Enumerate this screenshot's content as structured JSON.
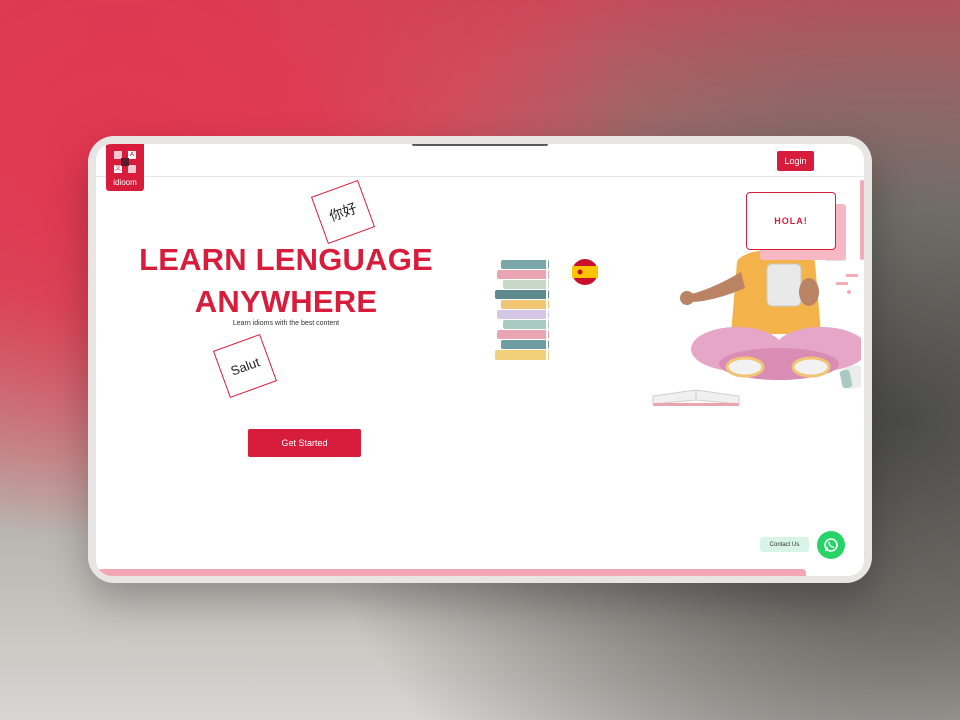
{
  "brand": {
    "logo_text": "idioom",
    "accent": "#d81d3c"
  },
  "header": {
    "login_label": "Login"
  },
  "hero": {
    "title_line1": "LEARN LENGUAGE",
    "title_line2": "ANYWHERE",
    "subtitle": "Learn idioms with the best content",
    "card_nihao": "你好",
    "card_salut": "Salut",
    "cta_label": "Get Started"
  },
  "illustration": {
    "speech_bubble": "HOLA!"
  },
  "contact": {
    "label": "Contact Us",
    "icon": "whatsapp-icon",
    "color": "#25d366"
  }
}
